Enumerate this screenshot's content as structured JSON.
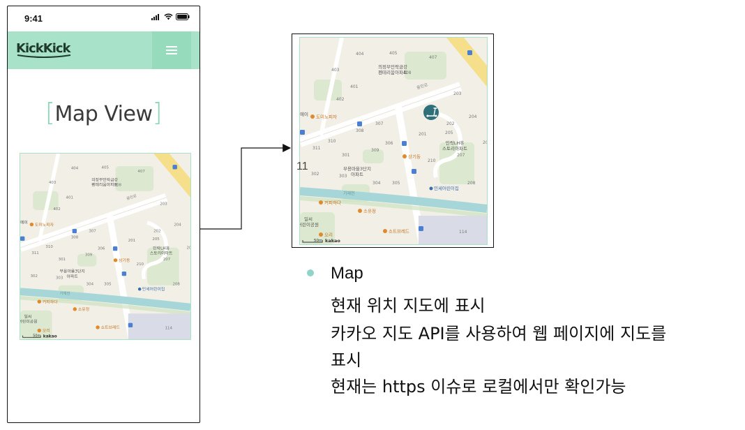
{
  "phone": {
    "time": "9:41",
    "logo_text": "KickKick",
    "menu_icon": "hamburger-icon",
    "page_title": "Map View",
    "title_bracket_left": "[",
    "title_bracket_right": "]"
  },
  "map_labels": {
    "b404": "404",
    "b405": "405",
    "b407": "407",
    "b403": "403",
    "b408": "408",
    "b401": "401",
    "b402": "402",
    "b203": "203",
    "b204": "204",
    "b202": "202",
    "b201": "201",
    "b205": "205",
    "b206": "206",
    "b207": "207",
    "b208": "208",
    "b210": "210",
    "b301": "301",
    "b302": "302",
    "b303": "303",
    "b304": "304",
    "b305": "305",
    "b306": "306",
    "b307": "307",
    "b308": "308",
    "b309": "309",
    "b310": "310",
    "b311": "311",
    "b114": "114",
    "apt_top": "의정부민락금강\n펜테리움아파트",
    "apt_right": "민락LH휴\n스토리아파트",
    "apt_left": "부용마을3단지\n아파트",
    "poi_dominol": "도미노피자",
    "poi_sanggi": "상기동",
    "poi_coffee": "커피하다",
    "poi_soyu": "소유정",
    "poi_ori": "오리",
    "poi_shorts": "쇼트브레드",
    "poi_child": "민세어린이집",
    "poi_park": "일씨\n어린이공원",
    "poi_pharm": "에이",
    "road_1": "용민로",
    "stream": "가재천",
    "scale": "50m",
    "brand": "kakao"
  },
  "zoom_label": "11",
  "description": {
    "heading": "Map",
    "lines": [
      "현재 위치 지도에 표시",
      "카카오 지도 API를 사용하여 웹 페이지에 지도를",
      "표시",
      "현재는 https 이슈로 로컬에서만 확인가능"
    ]
  },
  "colors": {
    "accent": "#a8e3c9",
    "accent_dark": "#96dbbb",
    "bullet": "#8fd3c9",
    "map_bg": "#f2efe7",
    "map_road": "#ffffff",
    "map_green": "#cde3bf",
    "map_water": "#a7d6d8",
    "map_highway": "#f5df8a",
    "marker": "#2f6f7a"
  }
}
